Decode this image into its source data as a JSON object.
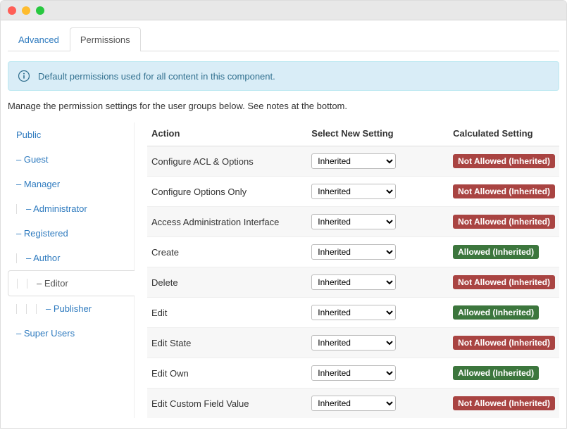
{
  "tabs": [
    {
      "label": "Advanced",
      "active": false
    },
    {
      "label": "Permissions",
      "active": true
    }
  ],
  "alert_text": "Default permissions used for all content in this component.",
  "intro_text": "Manage the permission settings for the user groups below. See notes at the bottom.",
  "sidebar": {
    "items": [
      {
        "label": "Public",
        "depth": 0,
        "selected": false
      },
      {
        "label": "– Guest",
        "depth": 0,
        "selected": false
      },
      {
        "label": "– Manager",
        "depth": 0,
        "selected": false
      },
      {
        "label": "– Administrator",
        "depth": 1,
        "selected": false
      },
      {
        "label": "– Registered",
        "depth": 0,
        "selected": false
      },
      {
        "label": "– Author",
        "depth": 1,
        "selected": false
      },
      {
        "label": "– Editor",
        "depth": 2,
        "selected": true
      },
      {
        "label": "– Publisher",
        "depth": 3,
        "selected": false
      },
      {
        "label": "– Super Users",
        "depth": 0,
        "selected": false
      }
    ]
  },
  "table": {
    "headers": {
      "action": "Action",
      "select": "Select New Setting",
      "calculated": "Calculated Setting"
    },
    "select_default": "Inherited",
    "rows": [
      {
        "action": "Configure ACL & Options",
        "setting": "Inherited",
        "calculated": "Not Allowed (Inherited)",
        "status": "not-allowed"
      },
      {
        "action": "Configure Options Only",
        "setting": "Inherited",
        "calculated": "Not Allowed (Inherited)",
        "status": "not-allowed"
      },
      {
        "action": "Access Administration Interface",
        "setting": "Inherited",
        "calculated": "Not Allowed (Inherited)",
        "status": "not-allowed"
      },
      {
        "action": "Create",
        "setting": "Inherited",
        "calculated": "Allowed (Inherited)",
        "status": "allowed"
      },
      {
        "action": "Delete",
        "setting": "Inherited",
        "calculated": "Not Allowed (Inherited)",
        "status": "not-allowed"
      },
      {
        "action": "Edit",
        "setting": "Inherited",
        "calculated": "Allowed (Inherited)",
        "status": "allowed"
      },
      {
        "action": "Edit State",
        "setting": "Inherited",
        "calculated": "Not Allowed (Inherited)",
        "status": "not-allowed"
      },
      {
        "action": "Edit Own",
        "setting": "Inherited",
        "calculated": "Allowed (Inherited)",
        "status": "allowed"
      },
      {
        "action": "Edit Custom Field Value",
        "setting": "Inherited",
        "calculated": "Not Allowed (Inherited)",
        "status": "not-allowed"
      }
    ]
  }
}
